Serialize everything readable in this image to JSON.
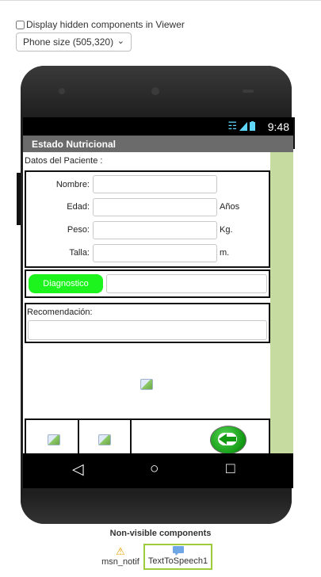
{
  "viewer": {
    "hidden_components_label": "Display hidden components in Viewer",
    "phone_size_selected": "Phone size (505,320)"
  },
  "status_bar": {
    "time": "9:48",
    "icons": [
      "wifi-icon",
      "signal-icon",
      "battery-icon"
    ]
  },
  "screen": {
    "title": "Estado Nutricional",
    "datos_label": "Datos del Paciente :",
    "form": [
      {
        "label": "Nombre:",
        "unit": ""
      },
      {
        "label": "Edad:",
        "unit": "Años"
      },
      {
        "label": "Peso:",
        "unit": "Kg."
      },
      {
        "label": "Talla:",
        "unit": "m."
      }
    ],
    "diagnostico_button": "Diagnostico",
    "recomendacion_label": "Recomendación:"
  },
  "navbar": {
    "back": "◁",
    "home": "○",
    "recent": "□"
  },
  "non_visible": {
    "title": "Non-visible components",
    "items": [
      {
        "name": "msn_notif",
        "icon": "warning-icon"
      },
      {
        "name": "TextToSpeech1",
        "icon": "speech-bubble-icon"
      }
    ]
  },
  "colors": {
    "diagnostico_button": "#1df41d",
    "right_strip": "#c6dba0",
    "title_bar": "#6b6b6b",
    "selected_component_border": "#9ccc3a"
  }
}
